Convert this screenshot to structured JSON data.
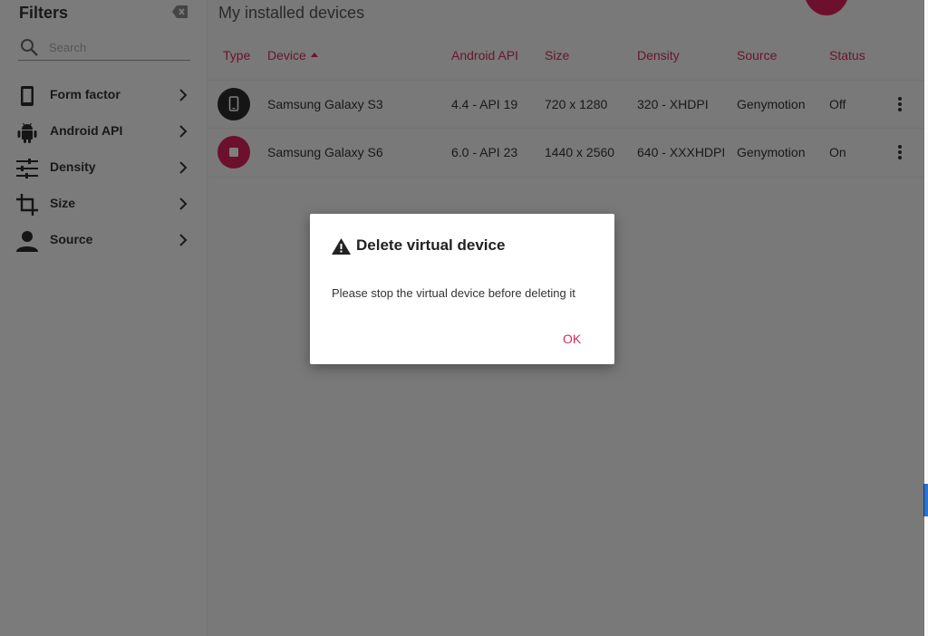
{
  "sidebar": {
    "title": "Filters",
    "search_placeholder": "Search",
    "items": [
      {
        "label": "Form factor",
        "icon": "phone-icon"
      },
      {
        "label": "Android API",
        "icon": "android-icon"
      },
      {
        "label": "Density",
        "icon": "tune-icon"
      },
      {
        "label": "Size",
        "icon": "crop-icon"
      },
      {
        "label": "Source",
        "icon": "person-icon"
      }
    ]
  },
  "main": {
    "title": "My installed devices",
    "columns": [
      "Type",
      "Device",
      "Android API",
      "Size",
      "Density",
      "Source",
      "Status"
    ],
    "sorted_column": "Device",
    "rows": [
      {
        "device": "Samsung Galaxy S3",
        "api": "4.4 - API 19",
        "size": "720 x 1280",
        "density": "320 - XHDPI",
        "source": "Genymotion",
        "status": "Off",
        "type_icon": "phone-icon"
      },
      {
        "device": "Samsung Galaxy S6",
        "api": "6.0 - API 23",
        "size": "1440 x 2560",
        "density": "640 - XXXHDPI",
        "source": "Genymotion",
        "status": "On",
        "type_icon": "stop-icon"
      }
    ]
  },
  "dialog": {
    "title": "Delete virtual device",
    "message": "Please stop the virtual device before deleting it",
    "ok_label": "OK"
  },
  "colors": {
    "accent": "#d42a5a",
    "overlay": "rgba(0,0,0,0.5)",
    "dark_icon": "#2b2b2b"
  }
}
